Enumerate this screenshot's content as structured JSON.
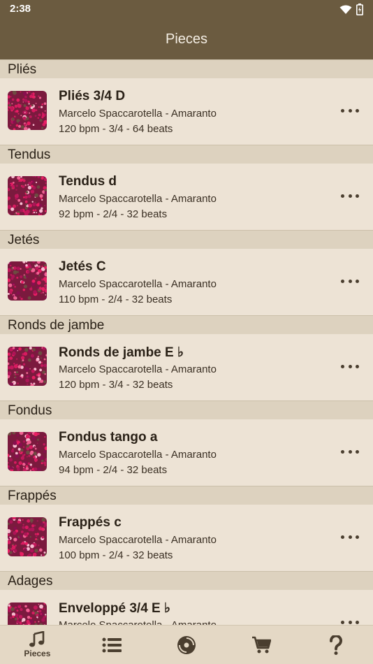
{
  "status": {
    "time": "2:38"
  },
  "app_bar": {
    "title": "Pieces"
  },
  "sections": [
    {
      "header": "Pliés",
      "item": {
        "title": "Pliés 3/4 D",
        "subtitle": "Marcelo Spaccarotella - Amaranto",
        "meta": "120 bpm - 3/4 - 64 beats"
      }
    },
    {
      "header": "Tendus",
      "item": {
        "title": "Tendus d",
        "subtitle": "Marcelo Spaccarotella - Amaranto",
        "meta": "92 bpm - 2/4 - 32 beats"
      }
    },
    {
      "header": "Jetés",
      "item": {
        "title": "Jetés C",
        "subtitle": "Marcelo Spaccarotella - Amaranto",
        "meta": "110 bpm - 2/4 - 32 beats"
      }
    },
    {
      "header": "Ronds de jambe",
      "item": {
        "title": "Ronds de jambe E ♭",
        "subtitle": "Marcelo Spaccarotella - Amaranto",
        "meta": "120 bpm - 3/4 - 32 beats"
      }
    },
    {
      "header": "Fondus",
      "item": {
        "title": "Fondus tango a",
        "subtitle": "Marcelo Spaccarotella - Amaranto",
        "meta": "94 bpm - 2/4 - 32 beats"
      }
    },
    {
      "header": "Frappés",
      "item": {
        "title": "Frappés c",
        "subtitle": "Marcelo Spaccarotella - Amaranto",
        "meta": "100 bpm - 2/4 - 32 beats"
      }
    },
    {
      "header": "Adages",
      "item": {
        "title": "Enveloppé 3/4 E ♭",
        "subtitle": "Marcelo Spaccarotella - Amaranto",
        "meta": ""
      }
    }
  ],
  "bottom_nav": {
    "items": [
      {
        "icon": "music-note-icon",
        "label": "Pieces",
        "active": true
      },
      {
        "icon": "list-icon",
        "label": ""
      },
      {
        "icon": "disc-icon",
        "label": ""
      },
      {
        "icon": "cart-icon",
        "label": ""
      },
      {
        "icon": "help-icon",
        "label": ""
      }
    ]
  },
  "colors": {
    "bar": "#6b5b40",
    "section": "#ddd2bf",
    "row": "#ede3d5",
    "nav": "#e4d8c5"
  }
}
